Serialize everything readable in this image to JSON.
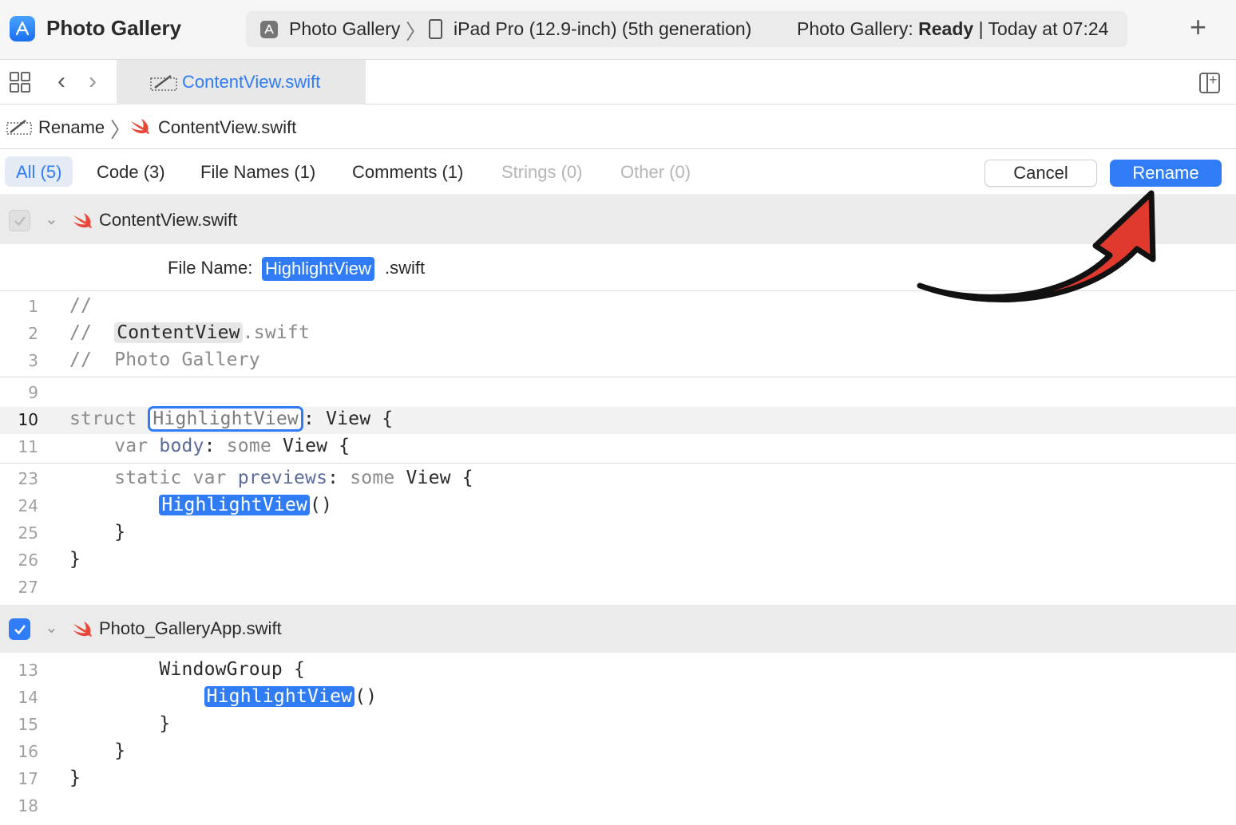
{
  "toolbar": {
    "app_title": "Photo Gallery",
    "scheme": "Photo Gallery",
    "device": "iPad Pro (12.9-inch) (5th generation)",
    "status_prefix": "Photo Gallery:",
    "status_state": "Ready",
    "status_time": "| Today at 07:24",
    "add_icon": "plus-icon"
  },
  "tab": {
    "label": "ContentView.swift"
  },
  "breadcrumb": {
    "operation": "Rename",
    "file": "ContentView.swift"
  },
  "filters": {
    "all": "All (5)",
    "code": "Code (3)",
    "file_names": "File Names (1)",
    "comments": "Comments (1)",
    "strings": "Strings (0)",
    "other": "Other (0)"
  },
  "actions": {
    "cancel": "Cancel",
    "rename": "Rename"
  },
  "groups": [
    {
      "name": "ContentView.swift",
      "checked": false
    },
    {
      "name": "Photo_GalleryApp.swift",
      "checked": true
    }
  ],
  "file_name_row": {
    "label": "File Name:",
    "new_name": "HighlightView",
    "ext": ".swift"
  },
  "code_group1": {
    "l1": {
      "n": "1",
      "text": "//"
    },
    "l2": {
      "n": "2",
      "prefix": "//  ",
      "hl": "ContentView",
      "suffix": ".swift"
    },
    "l3": {
      "n": "3",
      "text": "//  Photo Gallery"
    },
    "l9": {
      "n": "9"
    },
    "l10": {
      "n": "10",
      "kw": "struct ",
      "hl": "HighlightView",
      "suffix": ": View {"
    },
    "l11": {
      "n": "11",
      "indent": "    ",
      "kw1": "var ",
      "prop": "body",
      "mid": ": ",
      "kw2": "some ",
      "rest": "View {"
    },
    "l23": {
      "n": "23",
      "indent": "    ",
      "kw1": "static var ",
      "prop": "previews",
      "mid": ": ",
      "kw2": "some ",
      "rest": "View {"
    },
    "l24": {
      "n": "24",
      "indent": "        ",
      "hl": "HighlightView",
      "suffix": "()"
    },
    "l25": {
      "n": "25",
      "text": "    }"
    },
    "l26": {
      "n": "26",
      "text": "}"
    },
    "l27": {
      "n": "27"
    }
  },
  "code_group2": {
    "l13": {
      "n": "13",
      "text": "        WindowGroup {"
    },
    "l14": {
      "n": "14",
      "indent": "            ",
      "hl": "HighlightView",
      "suffix": "()"
    },
    "l15": {
      "n": "15",
      "text": "        }"
    },
    "l16": {
      "n": "16",
      "text": "    }"
    },
    "l17": {
      "n": "17",
      "text": "}"
    },
    "l18": {
      "n": "18"
    }
  },
  "colors": {
    "accent": "#2f7cf6",
    "annotation_arrow": "#e03a2f"
  }
}
